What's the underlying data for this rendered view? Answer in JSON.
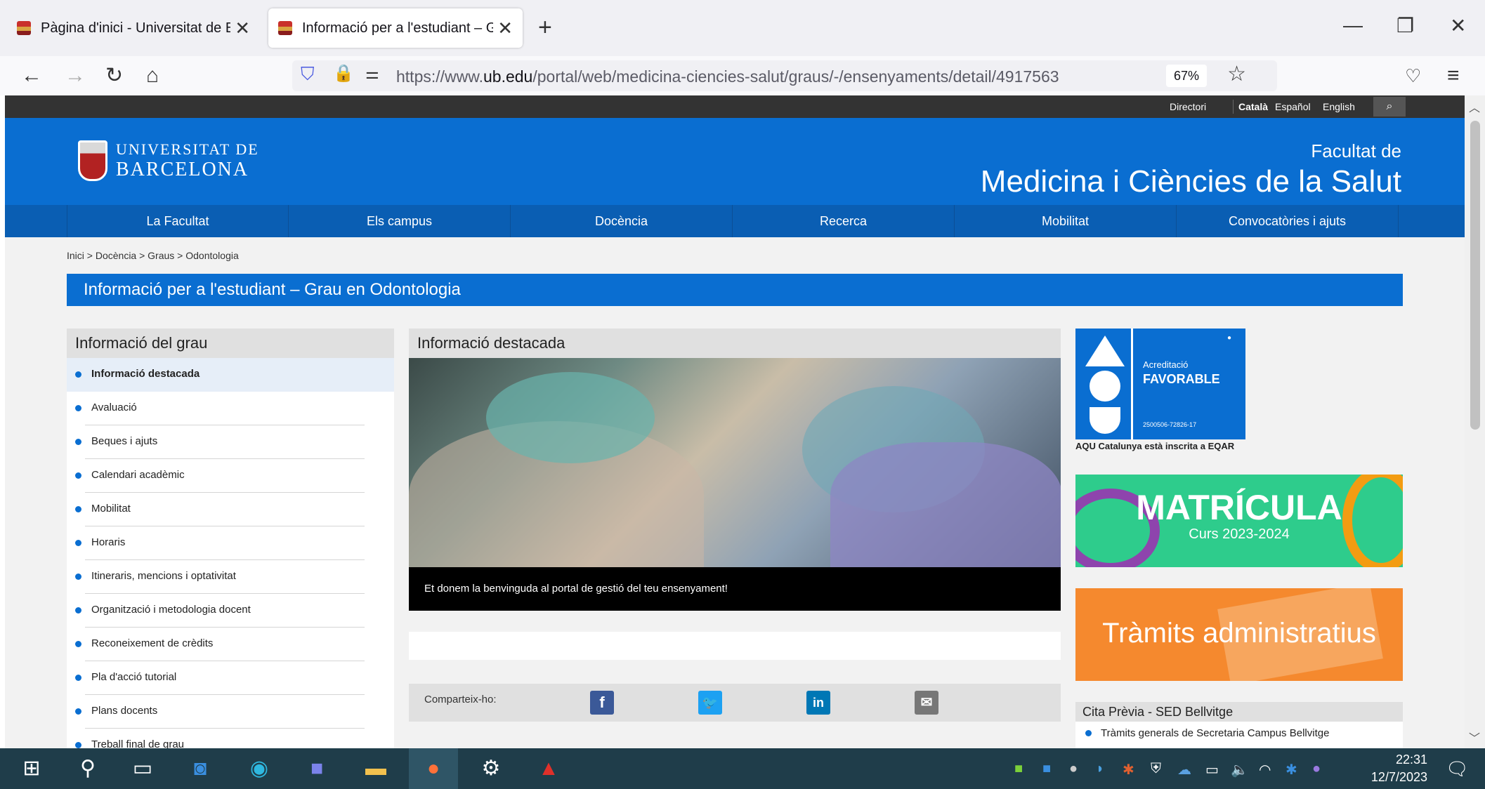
{
  "browser": {
    "tabs": [
      {
        "title": "Pàgina d'inici - Universitat de Ba"
      },
      {
        "title": "Informació per a l'estudiant – Gr"
      }
    ],
    "url_prefix": "https://www.",
    "url_domain": "ub.edu",
    "url_path": "/portal/web/medicina-ciencies-salut/graus/-/ensenyaments/detail/4917563",
    "zoom": "67%"
  },
  "site": {
    "topbar": {
      "directory": "Directori",
      "lang_ca": "Català",
      "lang_es": "Español",
      "lang_en": "English"
    },
    "logo_line1": "UNIVERSITAT DE",
    "logo_line2": "BARCELONA",
    "faculty_line1": "Facultat de",
    "faculty_line2": "Medicina i Ciències de la Salut",
    "nav": [
      "La Facultat",
      "Els campus",
      "Docència",
      "Recerca",
      "Mobilitat",
      "Convocatòries i ajuts"
    ],
    "breadcrumb": "Inici > Docència > Graus > Odontologia",
    "page_title": "Informació per a l'estudiant – Grau en Odontologia",
    "sidebar": {
      "heading": "Informació del grau",
      "items": [
        "Informació destacada",
        "Avaluació",
        "Beques i ajuts",
        "Calendari acadèmic",
        "Mobilitat",
        "Horaris",
        "Itineraris, mencions i optativitat",
        "Organització i metodologia docent",
        "Reconeixement de crèdits",
        "Pla d'acció tutorial",
        "Plans docents",
        "Treball final de grau"
      ]
    },
    "featured": {
      "heading": "Informació destacada",
      "caption": "Et donem la benvinguda al portal de gestió del teu ensenyament!"
    },
    "share_label": "Comparteix-ho:",
    "aqu": {
      "line1": "Acreditació",
      "line2": "FAVORABLE",
      "code": "2500506-72826-17",
      "note": "AQU Catalunya està inscrita a EQAR"
    },
    "matricula": {
      "title": "MATRÍCULA",
      "subtitle": "Curs 2023-2024"
    },
    "tramits": "Tràmits administratius",
    "cita": {
      "heading": "Cita Prèvia - SED Bellvitge",
      "item": "Tràmits generals de Secretaria Campus Bellvitge"
    }
  },
  "taskbar": {
    "time": "22:31",
    "date": "12/7/2023"
  }
}
